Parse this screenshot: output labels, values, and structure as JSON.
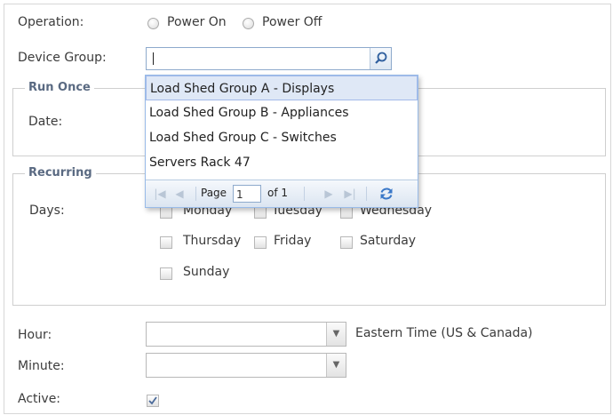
{
  "form": {
    "operation_label": "Operation:",
    "power_on_label": "Power On",
    "power_off_label": "Power Off",
    "device_group_label": "Device Group:",
    "device_group_value": "",
    "run_once": {
      "legend": "Run Once",
      "date_label": "Date:"
    },
    "recurring": {
      "legend": "Recurring",
      "days_label": "Days:",
      "days": [
        "Monday",
        "Tuesday",
        "Wednesday",
        "Thursday",
        "Friday",
        "Saturday",
        "Sunday"
      ]
    },
    "hour_label": "Hour:",
    "hour_value": "",
    "timezone_text": "Eastern Time (US & Canada)",
    "minute_label": "Minute:",
    "minute_value": "",
    "active_label": "Active:",
    "active_checked": true
  },
  "dropdown": {
    "items": [
      "Load Shed Group A - Displays",
      "Load Shed Group B - Appliances",
      "Load Shed Group C - Switches",
      "Servers Rack 47"
    ],
    "selected_index": 0,
    "pager": {
      "page_label": "Page",
      "page_value": "1",
      "of_label": "of 1"
    }
  },
  "icons": {
    "search": "magnifier-icon",
    "refresh": "refresh-icon",
    "check": "checkmark"
  }
}
